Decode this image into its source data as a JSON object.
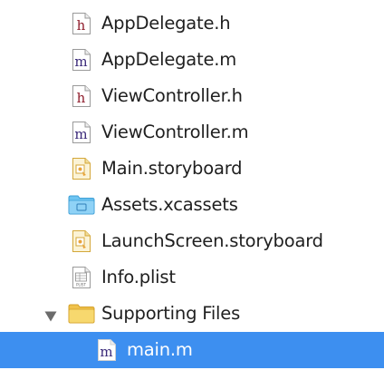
{
  "navigator": {
    "items": [
      {
        "label": "AppDelegate.h",
        "icon": "header-file-icon",
        "badge": "h"
      },
      {
        "label": "AppDelegate.m",
        "icon": "implementation-file-icon",
        "badge": "m"
      },
      {
        "label": "ViewController.h",
        "icon": "header-file-icon",
        "badge": "h"
      },
      {
        "label": "ViewController.m",
        "icon": "implementation-file-icon",
        "badge": "m"
      },
      {
        "label": "Main.storyboard",
        "icon": "storyboard-file-icon"
      },
      {
        "label": "Assets.xcassets",
        "icon": "asset-catalog-folder-icon"
      },
      {
        "label": "LaunchScreen.storyboard",
        "icon": "storyboard-file-icon"
      },
      {
        "label": "Info.plist",
        "icon": "plist-file-icon",
        "badge": "PLIST"
      },
      {
        "label": "Supporting Files",
        "icon": "group-folder-icon",
        "disclosure": "expanded"
      },
      {
        "label": "main.m",
        "icon": "implementation-file-icon",
        "badge": "m",
        "selected": true
      }
    ]
  },
  "colors": {
    "selection": "#3d8ff0",
    "header_badge": "#8e1b2a",
    "impl_badge": "#3b2a7a",
    "folder": "#f3cf5d",
    "asset_folder": "#6ec4f1"
  }
}
